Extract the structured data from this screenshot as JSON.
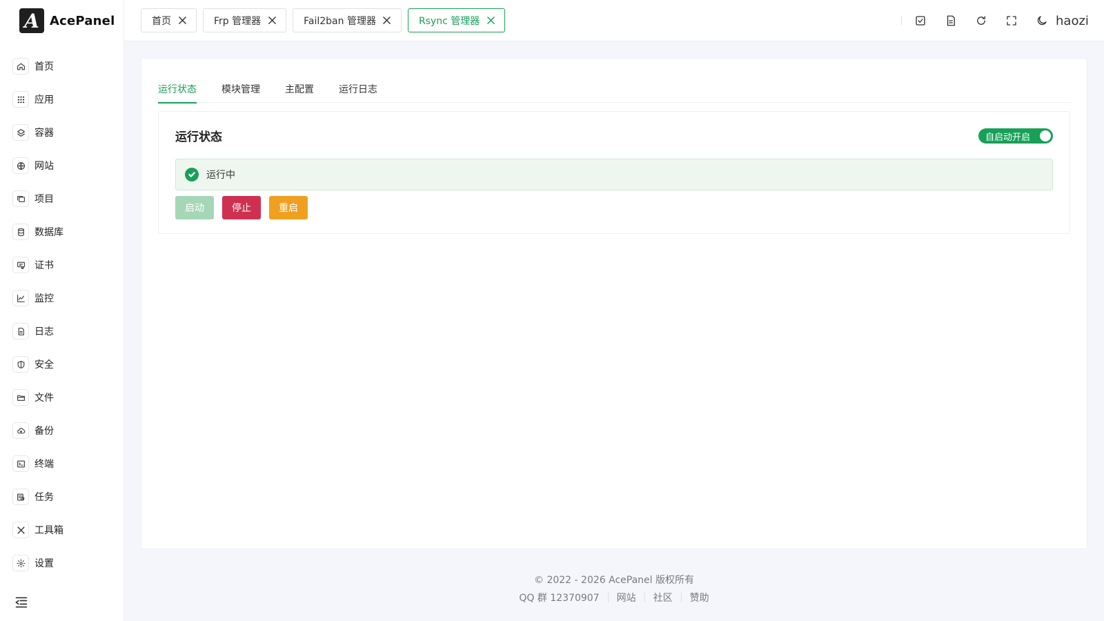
{
  "brand": {
    "name": "AcePanel",
    "logo_letter": "A"
  },
  "sidebar": {
    "items": [
      {
        "label": "首页",
        "icon": "home-icon"
      },
      {
        "label": "应用",
        "icon": "apps-icon"
      },
      {
        "label": "容器",
        "icon": "layers-icon"
      },
      {
        "label": "网站",
        "icon": "globe-icon"
      },
      {
        "label": "项目",
        "icon": "projects-icon"
      },
      {
        "label": "数据库",
        "icon": "database-icon"
      },
      {
        "label": "证书",
        "icon": "certificate-icon"
      },
      {
        "label": "监控",
        "icon": "chart-icon"
      },
      {
        "label": "日志",
        "icon": "log-icon"
      },
      {
        "label": "安全",
        "icon": "shield-icon"
      },
      {
        "label": "文件",
        "icon": "folder-icon"
      },
      {
        "label": "备份",
        "icon": "cloud-backup-icon"
      },
      {
        "label": "终端",
        "icon": "terminal-icon"
      },
      {
        "label": "任务",
        "icon": "tasks-icon"
      },
      {
        "label": "工具箱",
        "icon": "tools-icon"
      },
      {
        "label": "设置",
        "icon": "gear-icon"
      }
    ]
  },
  "header": {
    "tabs": [
      {
        "label": "首页",
        "active": false
      },
      {
        "label": "Frp 管理器",
        "active": false
      },
      {
        "label": "Fail2ban 管理器",
        "active": false
      },
      {
        "label": "Rsync 管理器",
        "active": true
      }
    ],
    "username": "haozi"
  },
  "main": {
    "subtabs": [
      {
        "label": "运行状态",
        "active": true
      },
      {
        "label": "模块管理",
        "active": false
      },
      {
        "label": "主配置",
        "active": false
      },
      {
        "label": "运行日志",
        "active": false
      }
    ],
    "panel": {
      "title": "运行状态",
      "autostart_label": "自启动开启",
      "autostart_on": true,
      "status_text": "运行中",
      "buttons": {
        "start": "启动",
        "stop": "停止",
        "restart": "重启"
      }
    }
  },
  "footer": {
    "copyright": "© 2022 - 2026 AcePanel 版权所有",
    "links": [
      "QQ 群 12370907",
      "网站",
      "社区",
      "赞助"
    ]
  },
  "colors": {
    "primary": "#18a058",
    "danger": "#d03050",
    "warning": "#f0a020",
    "primary_disabled": "#a5d7b7"
  }
}
